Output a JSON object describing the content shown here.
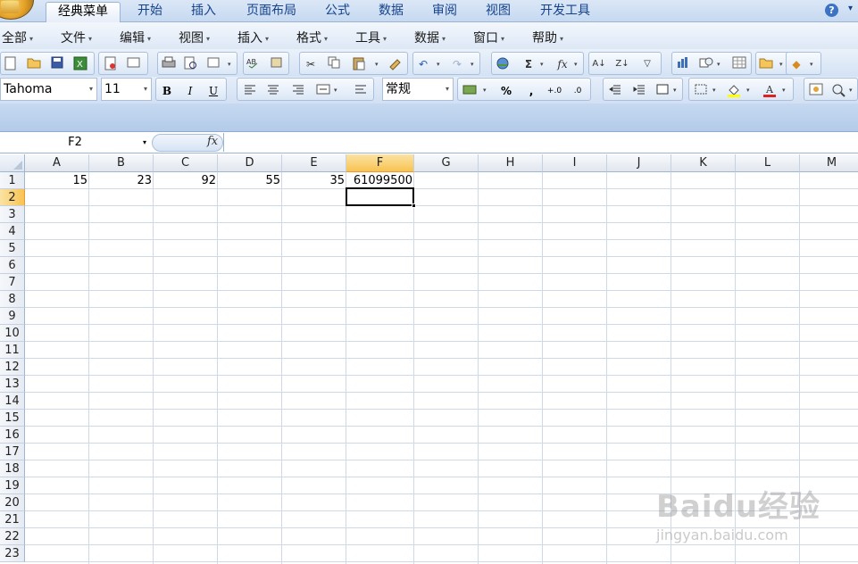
{
  "tabs": [
    {
      "label": "经典菜单",
      "active": true
    },
    {
      "label": "开始"
    },
    {
      "label": "插入"
    },
    {
      "label": "页面布局"
    },
    {
      "label": "公式"
    },
    {
      "label": "数据"
    },
    {
      "label": "审阅"
    },
    {
      "label": "视图"
    },
    {
      "label": "开发工具"
    }
  ],
  "menu": [
    "全部",
    "文件",
    "编辑",
    "视图",
    "插入",
    "格式",
    "工具",
    "数据",
    "窗口",
    "帮助"
  ],
  "format": {
    "font_name": "Tahoma",
    "font_size": "11",
    "bold": "B",
    "italic": "I",
    "underline": "U",
    "number_format": "常规",
    "percent": "%",
    "comma": ",",
    "sigma": "Σ",
    "fx": "fx"
  },
  "formula_bar": {
    "name_box": "F2",
    "fx_label": "fx",
    "content": ""
  },
  "sheet": {
    "columns": [
      "A",
      "B",
      "C",
      "D",
      "E",
      "F",
      "G",
      "H",
      "I",
      "J",
      "K",
      "L",
      "M"
    ],
    "rows": [
      "1",
      "2",
      "3",
      "4",
      "5",
      "6",
      "7",
      "8",
      "9",
      "10",
      "11",
      "12",
      "13",
      "14",
      "15",
      "16",
      "17",
      "18",
      "19",
      "20",
      "21",
      "22",
      "23"
    ],
    "selected_column": "F",
    "selected_row": "2",
    "row1": {
      "A": "15",
      "B": "23",
      "C": "92",
      "D": "55",
      "E": "35",
      "F": "61099500"
    }
  },
  "watermark": {
    "text": "Baidu经验",
    "url": "jingyan.baidu.com"
  },
  "colors": {
    "tab_text": "#15428b",
    "selected_header": "#f8c352",
    "gridline": "#d0d7e5"
  }
}
